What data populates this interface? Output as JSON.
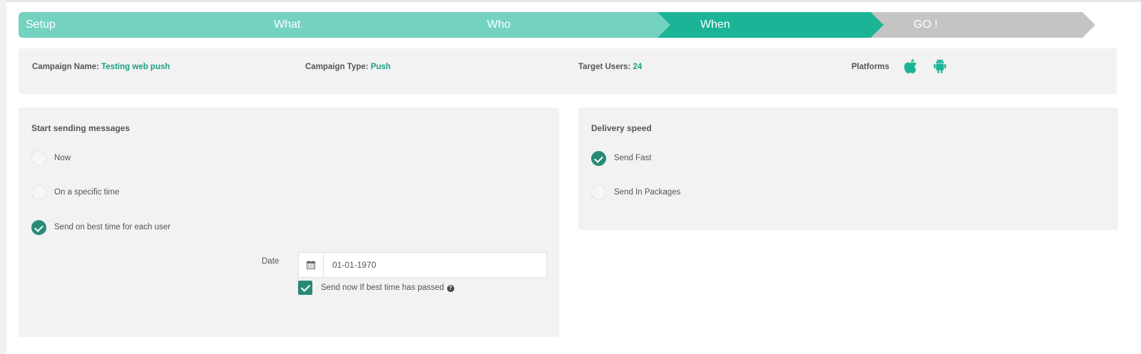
{
  "wizard": {
    "steps": [
      {
        "label": "Setup",
        "state": "done"
      },
      {
        "label": "What",
        "state": "done"
      },
      {
        "label": "Who",
        "state": "done"
      },
      {
        "label": "When",
        "state": "active"
      },
      {
        "label": "GO !",
        "state": "todo"
      }
    ]
  },
  "campaign": {
    "name_label": "Campaign Name:",
    "name_value": "Testing web push",
    "type_label": "Campaign Type:",
    "type_value": "Push",
    "target_label": "Target Users:",
    "target_value": "24",
    "platforms_label": "Platforms",
    "platform_icons": [
      "apple-icon",
      "android-icon"
    ]
  },
  "start_sending": {
    "title": "Start sending messages",
    "options": [
      {
        "label": "Now",
        "checked": false
      },
      {
        "label": "On a specific time",
        "checked": false
      },
      {
        "label": "Send on best time for each user",
        "checked": true
      }
    ],
    "date_label": "Date",
    "date_value": "01-01-1970",
    "send_now_label": "Send now If best time has passed",
    "send_now_checked": true
  },
  "delivery_speed": {
    "title": "Delivery speed",
    "options": [
      {
        "label": "Send Fast",
        "checked": true
      },
      {
        "label": "Send In Packages",
        "checked": false
      }
    ]
  },
  "colors": {
    "step_done": "#74d2c1",
    "step_active": "#1bb496",
    "step_todo": "#c4c4c4",
    "accent": "#1b9e84",
    "check": "#298a78"
  }
}
